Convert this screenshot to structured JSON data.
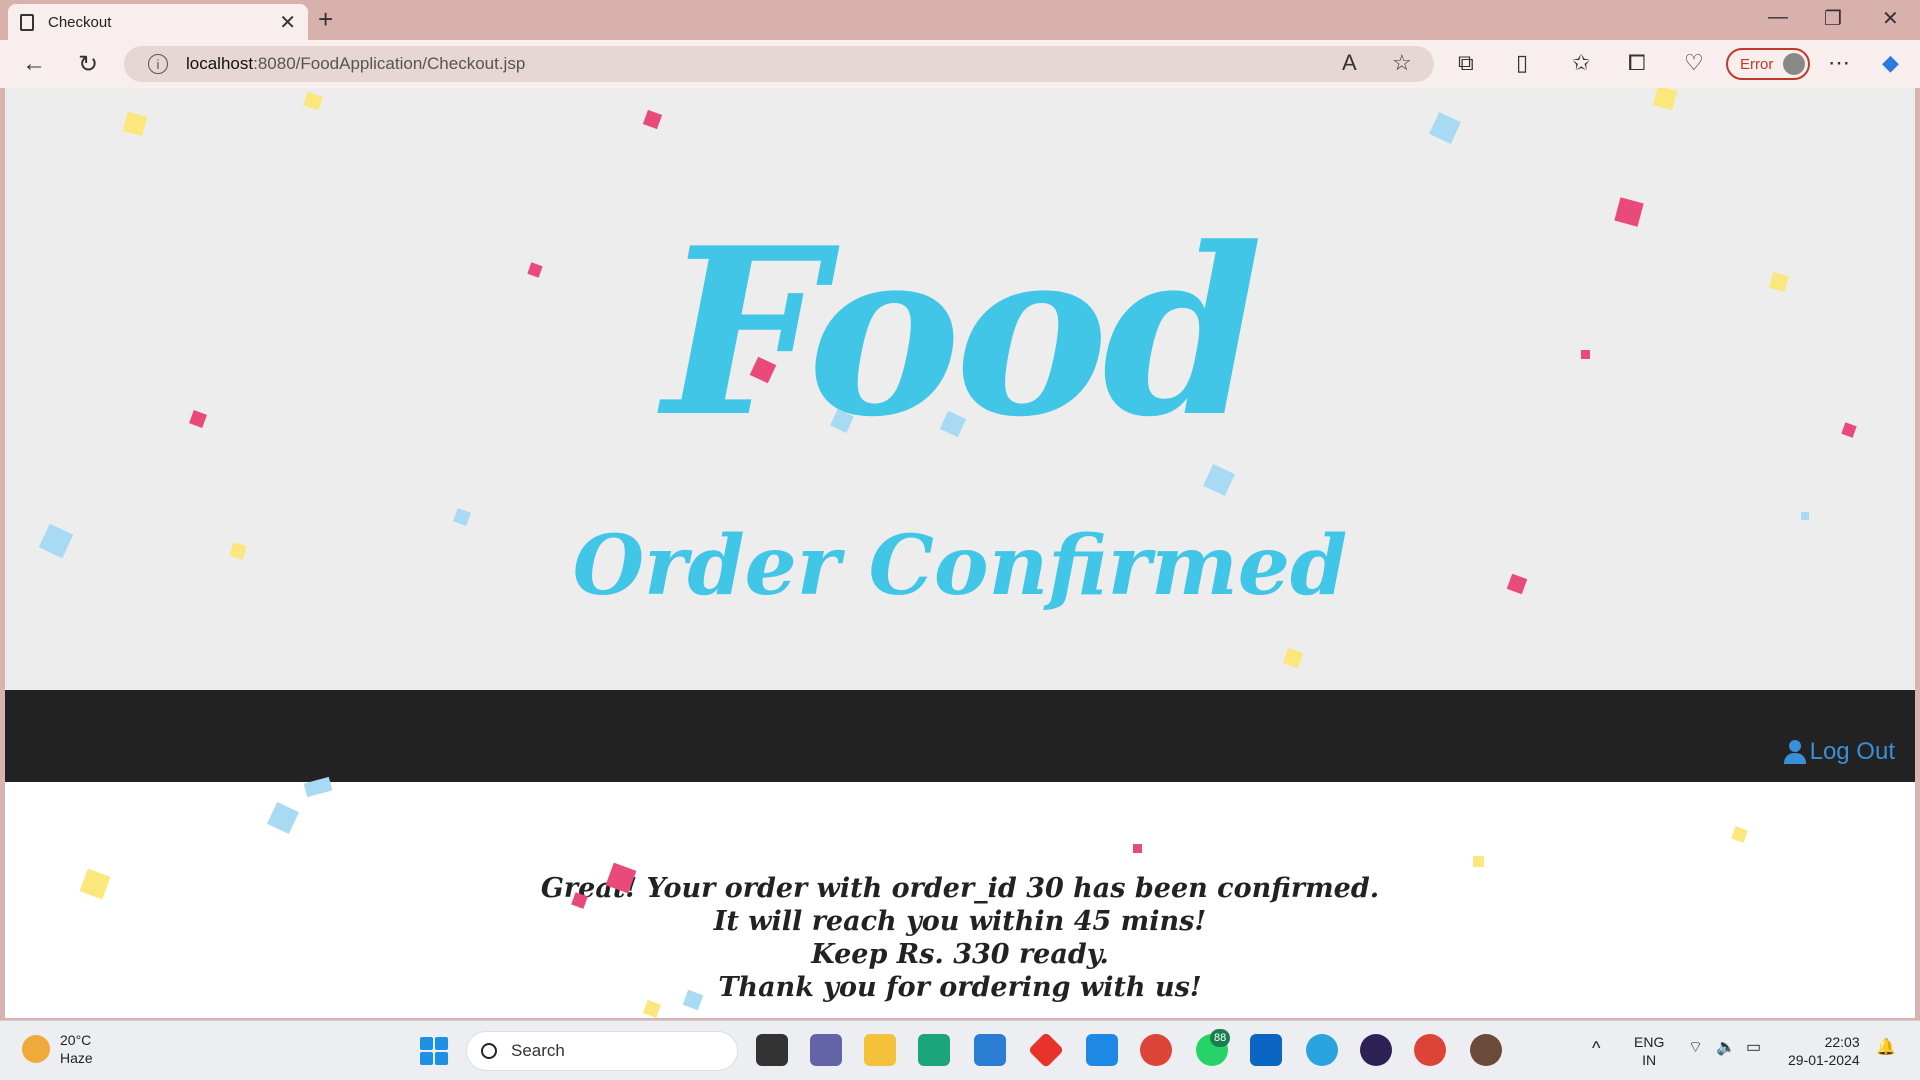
{
  "browser": {
    "tab_title": "Checkout",
    "url_host": "localhost",
    "url_path": ":8080/FoodApplication/Checkout.jsp",
    "profile_status": "Error"
  },
  "page": {
    "logo": "Food",
    "heading": "Order Confirmed",
    "logout_label": "Log Out",
    "message_lines": [
      "Great! Your order with order_id 30 has been confirmed.",
      "It will reach you within 45 mins!",
      "Keep Rs. 330 ready.",
      "Thank you for ordering with us!"
    ],
    "colors": {
      "accent": "#41c6e8",
      "navbar": "#222222",
      "link": "#3a8fd6"
    }
  },
  "taskbar": {
    "weather_temp": "20°C",
    "weather_desc": "Haze",
    "search_placeholder": "Search",
    "whatsapp_badge": "88",
    "lang_line1": "ENG",
    "lang_line2": "IN",
    "time": "22:03",
    "date": "29-01-2024"
  }
}
